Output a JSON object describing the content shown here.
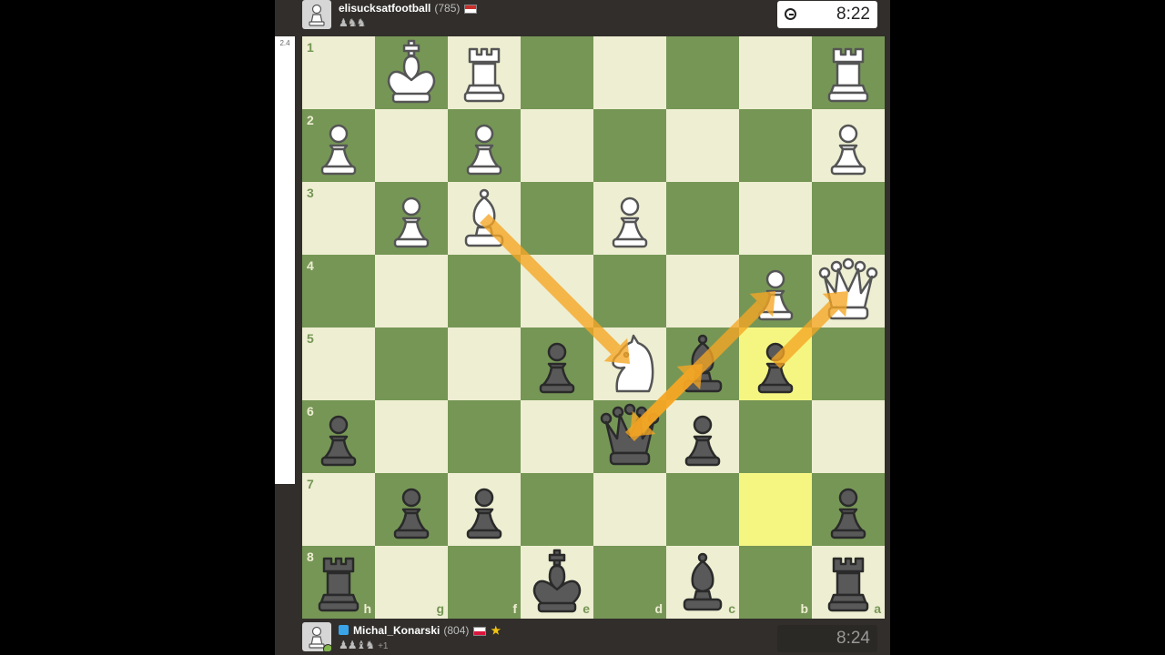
{
  "top_player": {
    "username": "elisucksatfootball",
    "rating": "(785)",
    "flag": "australia-flag",
    "captured_icons": [
      "pawn",
      "knight",
      "knight"
    ]
  },
  "bottom_player": {
    "username": "Michal_Konarski",
    "rating": "(804)",
    "flag": "poland-flag",
    "badge": "diamond-membership-icon",
    "status": "online",
    "captured_icons": [
      "pawn",
      "pawn",
      "bishop",
      "knight"
    ],
    "material_advantage": "+1"
  },
  "clocks": {
    "top": "8:22",
    "bottom": "8:24",
    "active": "top"
  },
  "eval_bar": {
    "value": "2.4"
  },
  "board": {
    "orientation": "black",
    "colors": {
      "light": "#eeeed2",
      "dark": "#769656",
      "highlight": "#f5f682",
      "arrow": "#f6a623"
    },
    "rank_labels": [
      "1",
      "2",
      "3",
      "4",
      "5",
      "6",
      "7",
      "8"
    ],
    "file_labels": [
      "h",
      "g",
      "f",
      "e",
      "d",
      "c",
      "b",
      "a"
    ],
    "highlighted_squares": [
      "b5",
      "b7"
    ],
    "pieces": [
      {
        "sq": "g1",
        "p": "wK"
      },
      {
        "sq": "f1",
        "p": "wR"
      },
      {
        "sq": "a1",
        "p": "wR"
      },
      {
        "sq": "h2",
        "p": "wP"
      },
      {
        "sq": "f2",
        "p": "wP"
      },
      {
        "sq": "a2",
        "p": "wP"
      },
      {
        "sq": "g3",
        "p": "wP"
      },
      {
        "sq": "f3",
        "p": "wB"
      },
      {
        "sq": "d3",
        "p": "wP"
      },
      {
        "sq": "b4",
        "p": "wP"
      },
      {
        "sq": "a4",
        "p": "wQ"
      },
      {
        "sq": "e5",
        "p": "bP"
      },
      {
        "sq": "d5",
        "p": "wN"
      },
      {
        "sq": "c5",
        "p": "bB"
      },
      {
        "sq": "b5",
        "p": "bP"
      },
      {
        "sq": "h6",
        "p": "bP"
      },
      {
        "sq": "d6",
        "p": "bQ"
      },
      {
        "sq": "c6",
        "p": "bP"
      },
      {
        "sq": "g7",
        "p": "bP"
      },
      {
        "sq": "f7",
        "p": "bP"
      },
      {
        "sq": "a7",
        "p": "bP"
      },
      {
        "sq": "h8",
        "p": "bR"
      },
      {
        "sq": "e8",
        "p": "bK"
      },
      {
        "sq": "c8",
        "p": "bB"
      },
      {
        "sq": "a8",
        "p": "bR"
      }
    ],
    "arrows": [
      {
        "from": "f3",
        "to": "d5"
      },
      {
        "from": "d6",
        "to": "c5"
      },
      {
        "from": "c5",
        "to": "b4"
      },
      {
        "from": "b5",
        "to": "a4"
      },
      {
        "from": "c5",
        "to": "d6"
      }
    ]
  }
}
